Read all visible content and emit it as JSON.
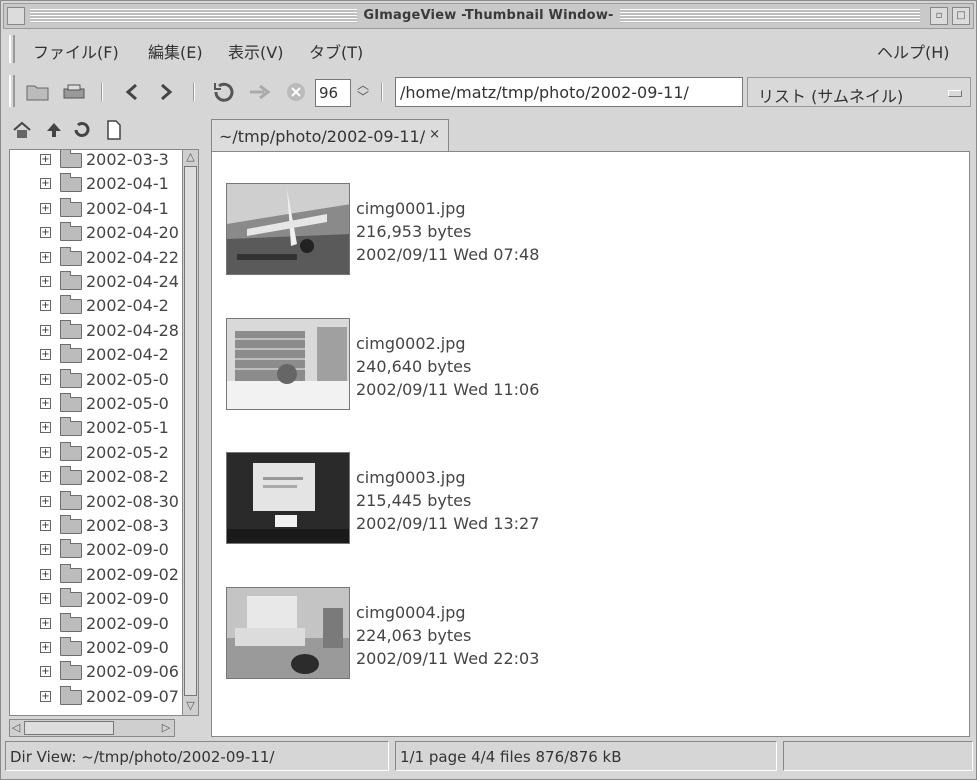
{
  "window": {
    "title": "GImageView -Thumbnail Window-"
  },
  "menubar": {
    "items": [
      "ファイル(F)",
      "編集(E)",
      "表示(V)",
      "タブ(T)"
    ],
    "help": "ヘルプ(H)"
  },
  "toolbar": {
    "zoom_value": "96",
    "path_value": "/home/matz/tmp/photo/2002-09-11/",
    "view_mode": "リスト (サムネイル)"
  },
  "tree": {
    "items": [
      "2002-03-3",
      "2002-04-1",
      "2002-04-1",
      "2002-04-20",
      "2002-04-22",
      "2002-04-24",
      "2002-04-2",
      "2002-04-28",
      "2002-04-2",
      "2002-05-0",
      "2002-05-0",
      "2002-05-1",
      "2002-05-2",
      "2002-08-2",
      "2002-08-30",
      "2002-08-3",
      "2002-09-0",
      "2002-09-02",
      "2002-09-0",
      "2002-09-0",
      "2002-09-0",
      "2002-09-06",
      "2002-09-07"
    ]
  },
  "tab": {
    "label": "~/tmp/photo/2002-09-11/",
    "close": "×"
  },
  "thumbnails": [
    {
      "name": "cimg0001.jpg",
      "size": "216,953 bytes",
      "date": "2002/09/11 Wed 07:48"
    },
    {
      "name": "cimg0002.jpg",
      "size": "240,640 bytes",
      "date": "2002/09/11 Wed 11:06"
    },
    {
      "name": "cimg0003.jpg",
      "size": "215,445 bytes",
      "date": "2002/09/11 Wed 13:27"
    },
    {
      "name": "cimg0004.jpg",
      "size": "224,063 bytes",
      "date": "2002/09/11 Wed 22:03"
    }
  ],
  "status": {
    "dir_view": "Dir View: ~/tmp/photo/2002-09-11/",
    "page_info": "1/1 page  4/4 files  876/876 kB",
    "extra": ""
  },
  "icons": {
    "home": "home-icon",
    "up": "arrow-up-icon",
    "refresh": "refresh-icon",
    "new": "new-file-icon",
    "open": "folder-open-icon",
    "print": "print-icon",
    "back": "chevron-left-icon",
    "forward": "chevron-right-icon",
    "reload": "reload-icon",
    "go": "arrow-right-icon",
    "stop": "stop-icon"
  }
}
